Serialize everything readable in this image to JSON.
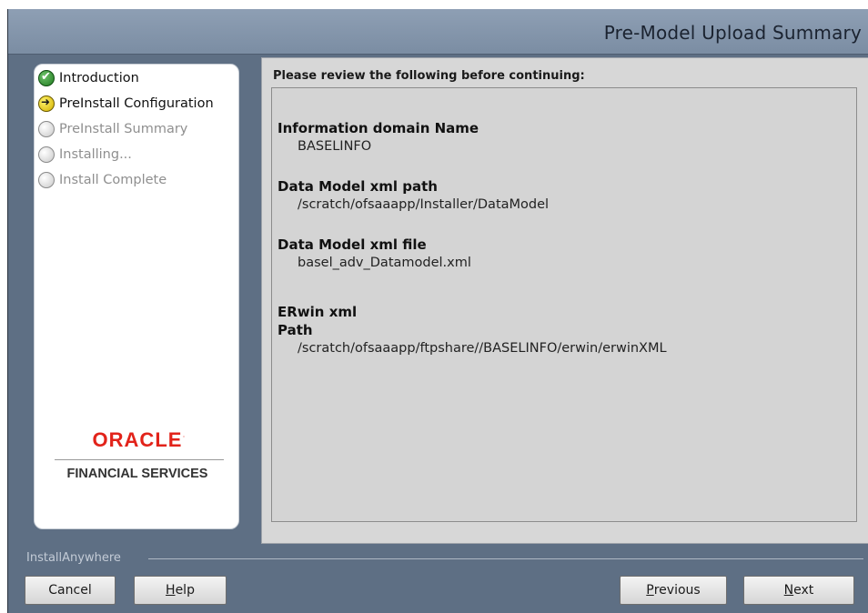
{
  "window": {
    "title": "Pre-Model Upload Summary"
  },
  "steps": [
    {
      "label": "Introduction",
      "state": "done",
      "icon": "check-circle-icon"
    },
    {
      "label": "PreInstall Configuration",
      "state": "current",
      "icon": "arrow-circle-icon"
    },
    {
      "label": "PreInstall Summary",
      "state": "pending",
      "icon": "empty-circle-icon"
    },
    {
      "label": "Installing...",
      "state": "pending",
      "icon": "empty-circle-icon"
    },
    {
      "label": "Install Complete",
      "state": "pending",
      "icon": "empty-circle-icon"
    }
  ],
  "branding": {
    "oracle": "ORACLE",
    "oracle_mark": "·",
    "financial_services": "FINANCIAL SERVICES"
  },
  "content": {
    "review_heading": "Please review the following before continuing:",
    "items": [
      {
        "label": "Information domain Name",
        "value": "BASELINFO"
      },
      {
        "label": "Data Model xml path",
        "value": "/scratch/ofsaaapp/Installer/DataModel"
      },
      {
        "label": "Data Model xml file",
        "value": "basel_adv_Datamodel.xml"
      },
      {
        "label": "ERwin xml",
        "label2": "Path",
        "value": "/scratch/ofsaaapp/ftpshare//BASELINFO/erwin/erwinXML"
      }
    ]
  },
  "footer": {
    "installer_name": "InstallAnywhere",
    "cancel_label": "Cancel",
    "help_prefix": "",
    "help_mnemonic": "H",
    "help_rest": "elp",
    "previous_mnemonic": "P",
    "previous_rest": "revious",
    "next_mnemonic": "N",
    "next_rest": "ext"
  },
  "colors": {
    "window_bg": "#5e6f84",
    "title_bar": "#8e9fb4",
    "oracle_red": "#e2231a",
    "content_bg": "#d7d7d7"
  }
}
